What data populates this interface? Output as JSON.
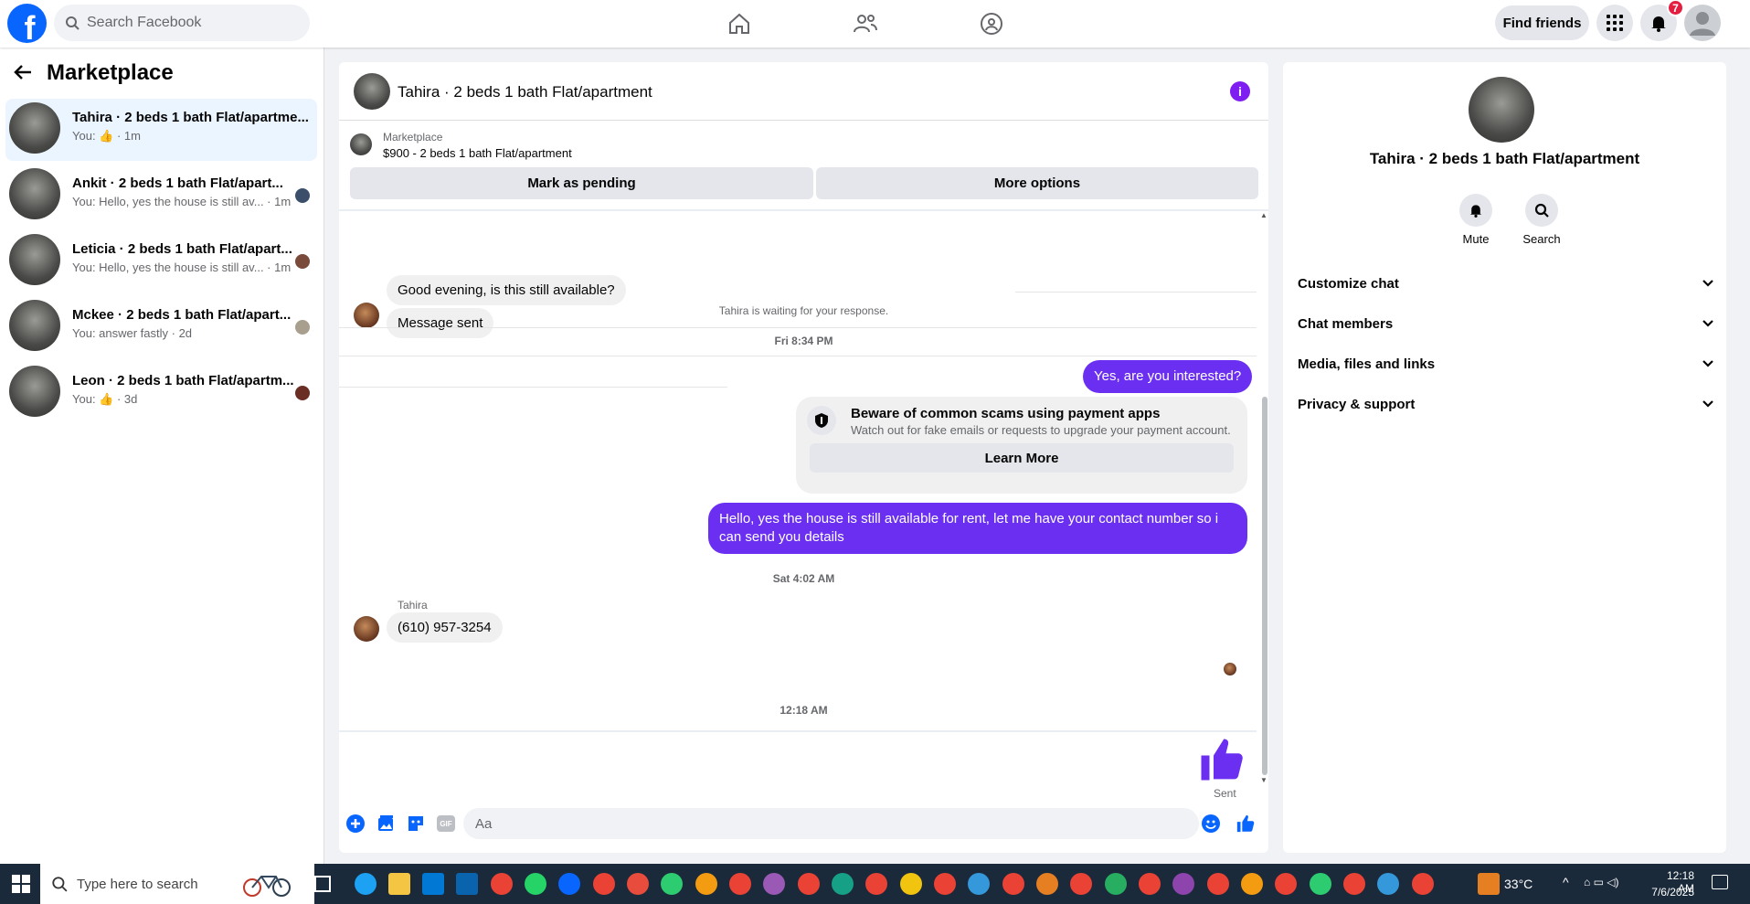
{
  "header": {
    "search_placeholder": "Search Facebook",
    "find_friends": "Find friends",
    "notification_count": "7",
    "icons": [
      "home-icon",
      "friends-icon",
      "groups-icon",
      "menu-grid-icon",
      "bell-icon",
      "account-icon"
    ]
  },
  "sidebar": {
    "title": "Marketplace",
    "conversations": [
      {
        "name": "Tahira · 2 beds 1 bath Flat/apartme...",
        "preview": "You: 👍 · 1m",
        "active": true
      },
      {
        "name": "Ankit · 2 beds 1 bath Flat/apart...",
        "preview": "You: Hello, yes the house is still av... · 1m"
      },
      {
        "name": "Leticia · 2 beds 1 bath Flat/apart...",
        "preview": "You: Hello, yes the house is still av... · 1m"
      },
      {
        "name": "Mckee · 2 beds 1 bath Flat/apart...",
        "preview": "You: answer fastly · 2d"
      },
      {
        "name": "Leon · 2 beds 1 bath Flat/apartm...",
        "preview": "You: 👍 · 3d"
      }
    ]
  },
  "chat": {
    "title": "Tahira · 2 beds 1 bath Flat/apartment",
    "marketplace_label": "Marketplace",
    "listing": "$900 - 2 beds 1 bath Flat/apartment",
    "mark_pending": "Mark as pending",
    "more_options": "More options",
    "messages": {
      "m1": "Good evening, is this still available?",
      "m2": "Message sent",
      "waiting": "Tahira is waiting for your response.",
      "ts1": "Fri 8:34 PM",
      "out1": "Yes, are you interested?",
      "scam_title": "Beware of common scams using payment apps",
      "scam_text": "Watch out for fake emails or requests to upgrade your payment account.",
      "scam_button": "Learn More",
      "out2": "Hello, yes the house is still available for rent, let me have your contact number so i can send you details",
      "ts2": "Sat 4:02 AM",
      "sender": "Tahira",
      "phone": "(610) 957-3254",
      "ts3": "12:18 AM",
      "sent": "Sent"
    },
    "composer_placeholder": "Aa"
  },
  "details": {
    "title": "Tahira · 2 beds 1 bath Flat/apartment",
    "mute": "Mute",
    "search": "Search",
    "sections": [
      "Customize chat",
      "Chat members",
      "Media, files and links",
      "Privacy & support"
    ]
  },
  "taskbar": {
    "search": "Type here to search",
    "temperature": "33°C",
    "time": "12:18 AM",
    "date": "7/6/2025"
  },
  "colors": {
    "accent": "#6b2ff2",
    "facebook_blue": "#0866ff",
    "badge_red": "#e41e3f"
  }
}
